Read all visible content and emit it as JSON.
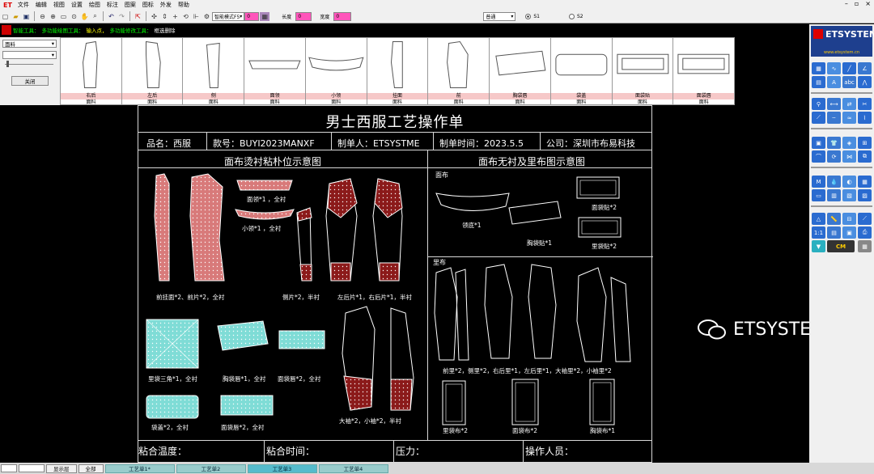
{
  "app": {
    "logo": "ET"
  },
  "menu": [
    "文件",
    "编辑",
    "视图",
    "设置",
    "绘图",
    "标注",
    "图案",
    "图标",
    "外发",
    "帮助"
  ],
  "toolbar": {
    "mode_select": "智能模式F5",
    "mode_value": "0",
    "length_label": "长度",
    "length_value": "0",
    "width_label": "宽度",
    "width_value": "0",
    "style_select": "普通",
    "radio_s1": "S1",
    "radio_s2": "S2"
  },
  "hint": {
    "items": [
      "智能工具：",
      "多功能绘图工具：",
      "输入点，",
      "多功能修改工具：",
      "框选删除"
    ]
  },
  "left_panel": {
    "fabric_select": "面料",
    "second_select": "",
    "close_button": "关闭"
  },
  "thumbnails": [
    {
      "label": "右后",
      "fabric": "面料"
    },
    {
      "label": "左后",
      "fabric": "面料"
    },
    {
      "label": "侧",
      "fabric": "面料"
    },
    {
      "label": "面领",
      "fabric": "面料"
    },
    {
      "label": "小领",
      "fabric": "面料"
    },
    {
      "label": "挂面",
      "fabric": "面料"
    },
    {
      "label": "前",
      "fabric": "面料"
    },
    {
      "label": "胸袋唇",
      "fabric": "面料"
    },
    {
      "label": "袋盖",
      "fabric": "面料"
    },
    {
      "label": "面袋贴",
      "fabric": "面料"
    },
    {
      "label": "面袋唇",
      "fabric": "面料"
    }
  ],
  "sheet": {
    "title": "男士西服工艺操作单",
    "product_name": "品名：西服",
    "style_no": "款号：BUYI2023MANXF",
    "maker": "制单人：ETSYSTME",
    "make_time": "制单时间：2023.5.5",
    "company": "公司：深圳市布易科技",
    "section_left": "面布烫衬粘朴位示意图",
    "section_right": "面布无衬及里布图示意图",
    "fabric_heading": "面布",
    "lining_heading": "里布",
    "labels_left": {
      "front": "前挂面*2、前片*2，全衬",
      "collar": "面领*1 ，全衬",
      "small_collar": "小领*1 ，全衬",
      "side": "侧片*2，半衬",
      "back": "左后片*1，右后片*1，半衬",
      "inner_triangle": "里袋三角*1，全衬",
      "chest_lip": "胸袋唇*1，全衬",
      "face_lip": "面袋唇*2，全衬",
      "sleeve": "大袖*2，小袖*2，半衬",
      "flap": "袋盖*2，全衬",
      "face_lip2": "面袋唇*2，全衬"
    },
    "labels_right": {
      "collar_base": "领底*1",
      "chest_patch": "胸袋贴*1",
      "face_patch": "面袋贴*2",
      "lining_patch": "里袋贴*2",
      "lining_main": "前里*2，侧里*2，右后里*1，左后里*1，大袖里*2，小袖里*2",
      "lining_bag": "里袋布*2",
      "face_bag": "面袋布*2",
      "chest_bag": "胸袋布*1"
    },
    "footer": {
      "temp": "粘合温度：",
      "time": "粘合时间：",
      "pressure": "压力：",
      "operator": "操作人员："
    }
  },
  "watermark": "ETSYSTEM",
  "right_panel": {
    "logo_text": "ETSYSTEM",
    "logo_url": "www.etsystem.cn",
    "size_label": "1:1",
    "cm_label": "CM"
  },
  "statusbar": {
    "display_layer": "显示层",
    "all": "全部",
    "tabs": [
      "工艺单1*",
      "工艺单2",
      "工艺单3",
      "工艺单4"
    ],
    "active_tab": 2
  },
  "colors": {
    "fusing_red": "#d87a7a",
    "fusing_dark": "#8b1a1a",
    "fusing_cyan": "#7fdcd6",
    "panel_blue": "#1e3f8e"
  }
}
